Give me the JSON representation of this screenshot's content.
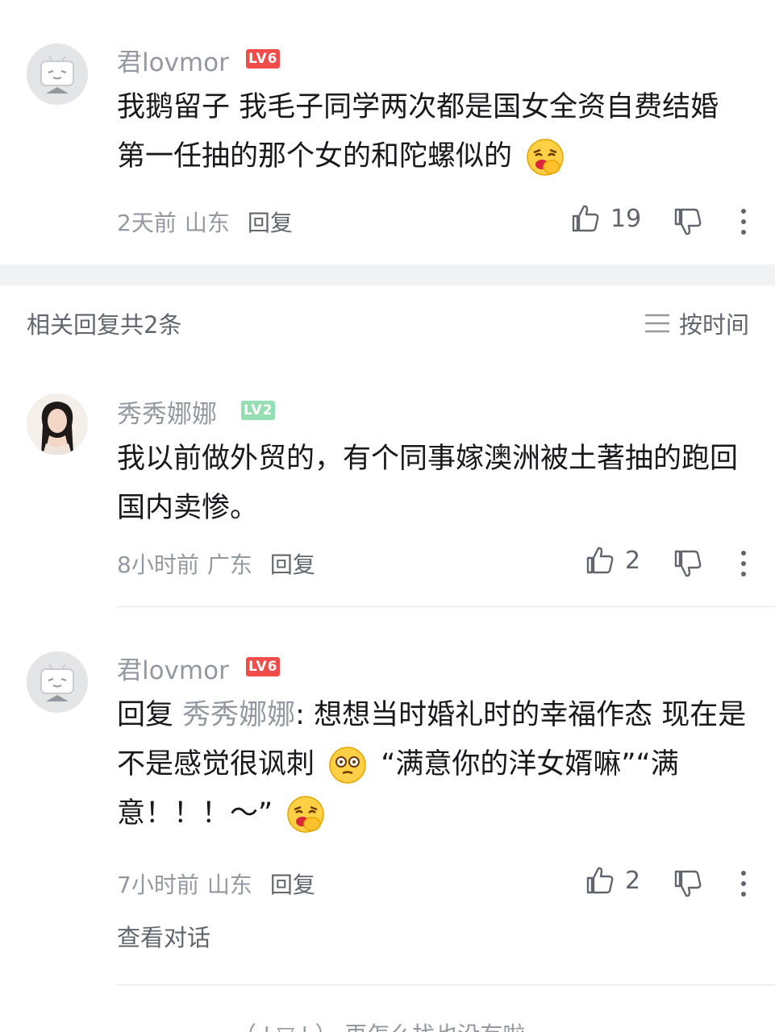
{
  "colors": {
    "lv6": "#f04c49",
    "lv2": "#95ddb2",
    "band": "#f1f2f3"
  },
  "main_comment": {
    "username": "君lovmor",
    "level": "LV6",
    "text": "我鹅留子  我毛子同学两次都是国女全资自费结婚  第一任抽的那个女的和陀螺似的",
    "emoji": "laugh-cover-mouth-emoji",
    "time": "2天前",
    "location": "山东",
    "reply_label": "回复",
    "likes": "19"
  },
  "replies_header": {
    "title": "相关回复共2条",
    "sort_label": "按时间"
  },
  "replies": [
    {
      "username": "秀秀娜娜",
      "level": "LV2",
      "text": "我以前做外贸的，有个同事嫁澳洲被土著抽的跑回国内卖惨。",
      "time": "8小时前",
      "location": "广东",
      "reply_label": "回复",
      "likes": "2"
    },
    {
      "username": "君lovmor",
      "level": "LV6",
      "reply_prefix": "回复",
      "reply_to": "秀秀娜娜",
      "text_1": ": 想想当时婚礼时的幸福作态  现在是不是感觉很讽刺",
      "text_2": "  “满意你的洋女婿嘛”“满意！！！～”",
      "time": "7小时前",
      "location": "山东",
      "reply_label": "回复",
      "likes": "2",
      "view_conversation": "查看对话"
    }
  ],
  "footer": {
    "text": "（ ' ▽ ' ）  再怎么找也没有啦"
  }
}
